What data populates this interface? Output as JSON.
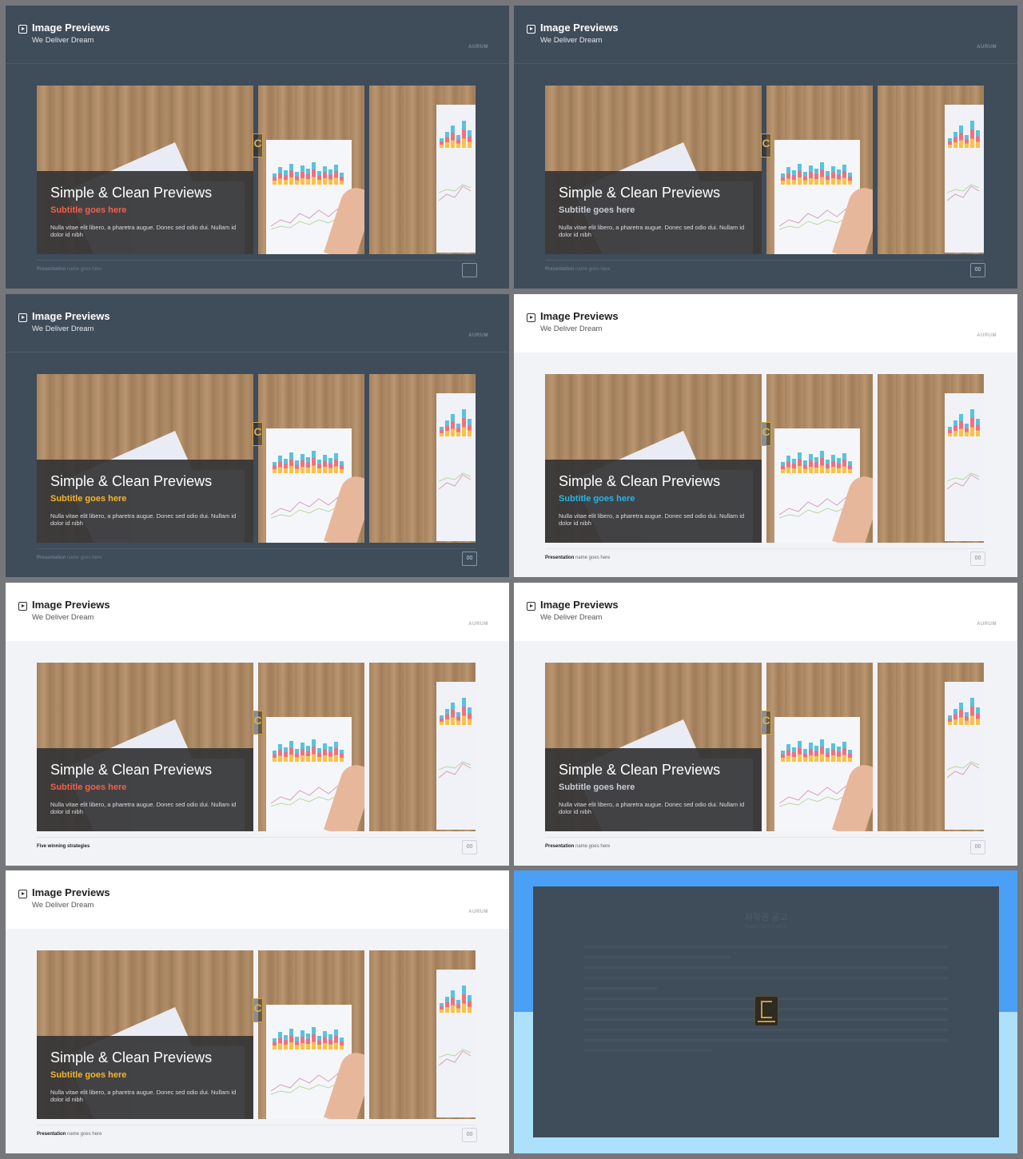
{
  "slides": [
    {
      "theme": "dark",
      "title": "Image Previews",
      "subtitle": "We Deliver Dream",
      "brand": "AURUM",
      "caption_title": "Simple & Clean Previews",
      "caption_subtitle": "Subtitle goes here",
      "caption_subtitle_color": "#f26049",
      "caption_body": "Nulla vitae elit libero, a pharetra augue. Donec sed odio dui. Nullam id dolor id nibh",
      "footer_bold": "Presentation",
      "footer_rest": " name goes here",
      "page": ""
    },
    {
      "theme": "dark",
      "title": "Image Previews",
      "subtitle": "We Deliver Dream",
      "brand": "AURUM",
      "caption_title": "Simple & Clean Previews",
      "caption_subtitle": "Subtitle goes here",
      "caption_subtitle_color": "#c7cdd5",
      "caption_body": "Nulla vitae elit libero, a pharetra augue. Donec sed odio dui. Nullam id dolor id nibh",
      "footer_bold": "Presentation",
      "footer_rest": " name goes here",
      "page": "00"
    },
    {
      "theme": "dark",
      "title": "Image Previews",
      "subtitle": "We Deliver Dream",
      "brand": "AURUM",
      "caption_title": "Simple & Clean Previews",
      "caption_subtitle": "Subtitle goes here",
      "caption_subtitle_color": "#f7b52a",
      "caption_body": "Nulla vitae elit libero, a pharetra augue. Donec sed odio dui. Nullam id dolor id nibh",
      "footer_bold": "Presentation",
      "footer_rest": " name goes here",
      "page": "00"
    },
    {
      "theme": "light",
      "title": "Image Previews",
      "subtitle": "We Deliver Dream",
      "brand": "AURUM",
      "caption_title": "Simple & Clean Previews",
      "caption_subtitle": "Subtitle goes here",
      "caption_subtitle_color": "#22b7e7",
      "caption_body": "Nulla vitae elit libero, a pharetra augue. Donec sed odio dui. Nullam id dolor id nibh",
      "footer_bold": "Presentation",
      "footer_rest": " name goes here",
      "page": "00"
    },
    {
      "theme": "light",
      "title": "Image Previews",
      "subtitle": "We Deliver Dream",
      "brand": "AURUM",
      "caption_title": "Simple & Clean Previews",
      "caption_subtitle": "Subtitle goes here",
      "caption_subtitle_color": "#f26049",
      "caption_body": "Nulla vitae elit libero, a pharetra augue. Donec sed odio dui. Nullam id dolor id nibh",
      "footer_bold": "Five winning strategies",
      "footer_rest": "",
      "page": "00"
    },
    {
      "theme": "light",
      "title": "Image Previews",
      "subtitle": "We Deliver Dream",
      "brand": "AURUM",
      "caption_title": "Simple & Clean Previews",
      "caption_subtitle": "Subtitle goes here",
      "caption_subtitle_color": "#c7cdd5",
      "caption_body": "Nulla vitae elit libero, a pharetra augue. Donec sed odio dui. Nullam id dolor id nibh",
      "footer_bold": "Presentation",
      "footer_rest": " name goes here",
      "page": "00"
    },
    {
      "theme": "light",
      "title": "Image Previews",
      "subtitle": "We Deliver Dream",
      "brand": "AURUM",
      "caption_title": "Simple & Clean Previews",
      "caption_subtitle": "Subtitle goes here",
      "caption_subtitle_color": "#f7b52a",
      "caption_body": "Nulla vitae elit libero, a pharetra augue. Donec sed odio dui. Nullam id dolor id nibh",
      "footer_bold": "Presentation",
      "footer_rest": " name goes here",
      "page": "00"
    }
  ],
  "copyright": {
    "title": "저작권 공고",
    "subtitle": "Copyright Notice"
  },
  "colors": {
    "dark_bg": "#3f4c5a",
    "light_bg": "#f2f3f7",
    "copyright_top": "#4aa0f5",
    "copyright_bottom": "#ade0fc"
  }
}
